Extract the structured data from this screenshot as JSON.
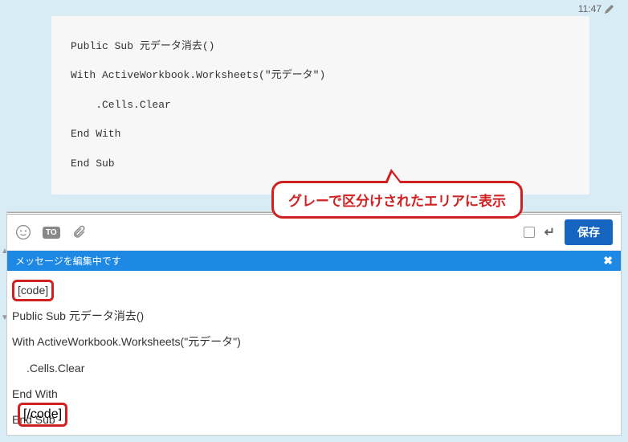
{
  "meta": {
    "timestamp": "11:47"
  },
  "code_block": {
    "lines": [
      "Public Sub 元データ消去()",
      "With ActiveWorkbook.Worksheets(\"元データ\")",
      "    .Cells.Clear",
      "End With",
      "End Sub"
    ]
  },
  "callout": {
    "text": "グレーで区分けされたエリアに表示"
  },
  "toolbar": {
    "to_label": "TO",
    "save_label": "保存"
  },
  "status_bar": {
    "message": "メッセージを編集中です",
    "close": "✖"
  },
  "editor": {
    "tag_open": "[code]",
    "tag_close": "[/code]",
    "lines": [
      "Public Sub 元データ消去()",
      "With ActiveWorkbook.Worksheets(\"元データ\")",
      ".Cells.Clear",
      "End With",
      "End Sub"
    ]
  }
}
